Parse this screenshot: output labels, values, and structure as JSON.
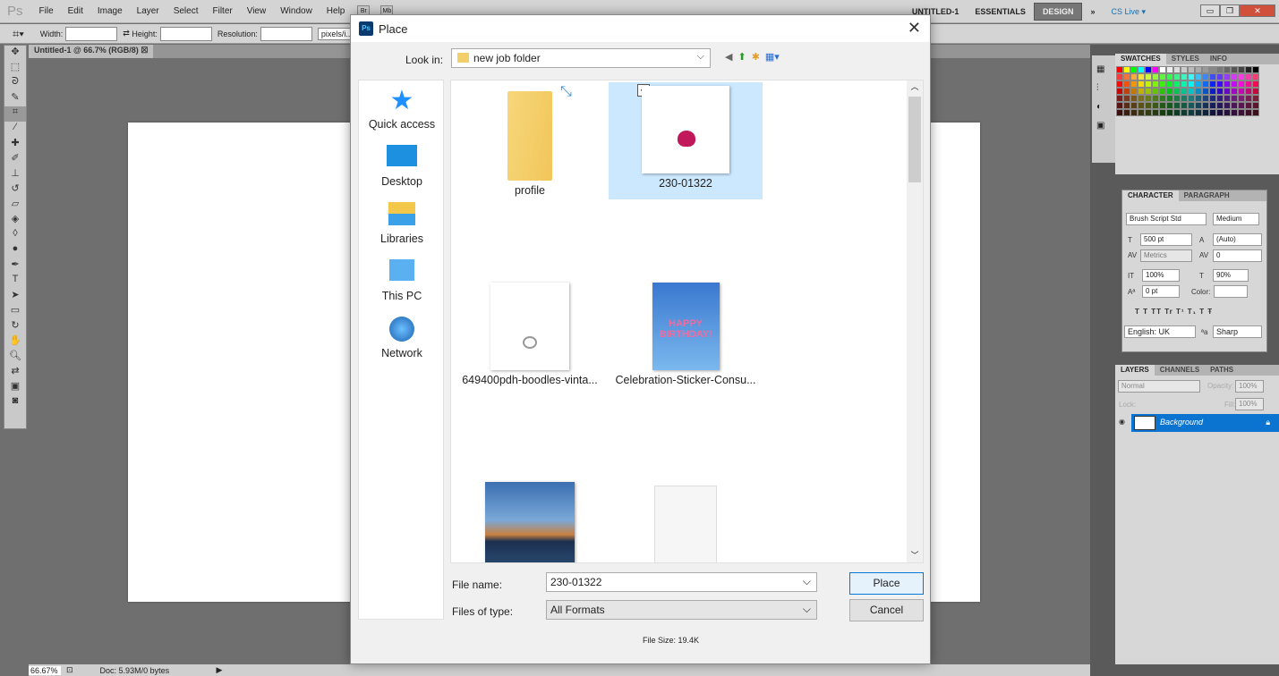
{
  "app": {
    "logo": "Ps",
    "menus": [
      "File",
      "Edit",
      "Image",
      "Layer",
      "Select",
      "Filter",
      "View",
      "Window",
      "Help"
    ],
    "bridge_btns": [
      "Br",
      "Mb"
    ],
    "workspaces": [
      "UNTITLED-1",
      "ESSENTIALS",
      "DESIGN"
    ],
    "active_workspace": "DESIGN",
    "more": "»",
    "cs_live": "CS Live ▾"
  },
  "options": {
    "width_label": "Width:",
    "height_label": "Height:",
    "resolution_label": "Resolution:",
    "unit": "pixels/i...",
    "width": "",
    "height": "",
    "resolution": ""
  },
  "document": {
    "tab": "Untitled-1 @ 66.7% (RGB/8)",
    "zoom": "66.67%",
    "doc_size": "Doc: 5.93M/0 bytes"
  },
  "panels": {
    "swatches_tabs": [
      "SWATCHES",
      "STYLES",
      "INFO"
    ],
    "character": {
      "tabs": [
        "CHARACTER",
        "PARAGRAPH"
      ],
      "font": "Brush Script Std",
      "style": "Medium",
      "size": "500 pt",
      "leading": "(Auto)",
      "kerning": "Metrics",
      "tracking": "0",
      "vscale": "100%",
      "hscale": "90%",
      "baseline": "0 pt",
      "color_label": "Color:",
      "styles": "T  T  TT  Tr  T¹  T₁  T  Ŧ",
      "language": "English: UK",
      "aa_label": "ªa",
      "antialias": "Sharp"
    },
    "layers": {
      "tabs": [
        "LAYERS",
        "CHANNELS",
        "PATHS"
      ],
      "blend": "Normal",
      "opacity_label": "Opacity:",
      "opacity": "100%",
      "lock_label": "Lock:",
      "fill_label": "Fill:",
      "fill": "100%",
      "layer_name": "Background"
    }
  },
  "dialog": {
    "title": "Place",
    "lookin_label": "Look in:",
    "lookin": "new job folder",
    "places": [
      "Quick access",
      "Desktop",
      "Libraries",
      "This PC",
      "Network"
    ],
    "files": [
      {
        "name": "profile",
        "type": "folder"
      },
      {
        "name": "230-01322",
        "type": "image",
        "selected": true
      },
      {
        "name": "649400pdh-boodles-vinta...",
        "type": "image"
      },
      {
        "name": "Celebration-Sticker-Consu...",
        "type": "image",
        "text": "HAPPY BIRTHDAY!"
      },
      {
        "name": "",
        "type": "image"
      },
      {
        "name": "",
        "type": "file"
      }
    ],
    "filename_label": "File name:",
    "filename": "230-01322",
    "filetype_label": "Files of type:",
    "filetype": "All Formats",
    "place_btn": "Place",
    "cancel_btn": "Cancel",
    "filesize": "File Size: 19.4K"
  },
  "colors": {
    "accent": "#0a74d0",
    "selection": "#cce8ff",
    "close": "#d0503c"
  }
}
